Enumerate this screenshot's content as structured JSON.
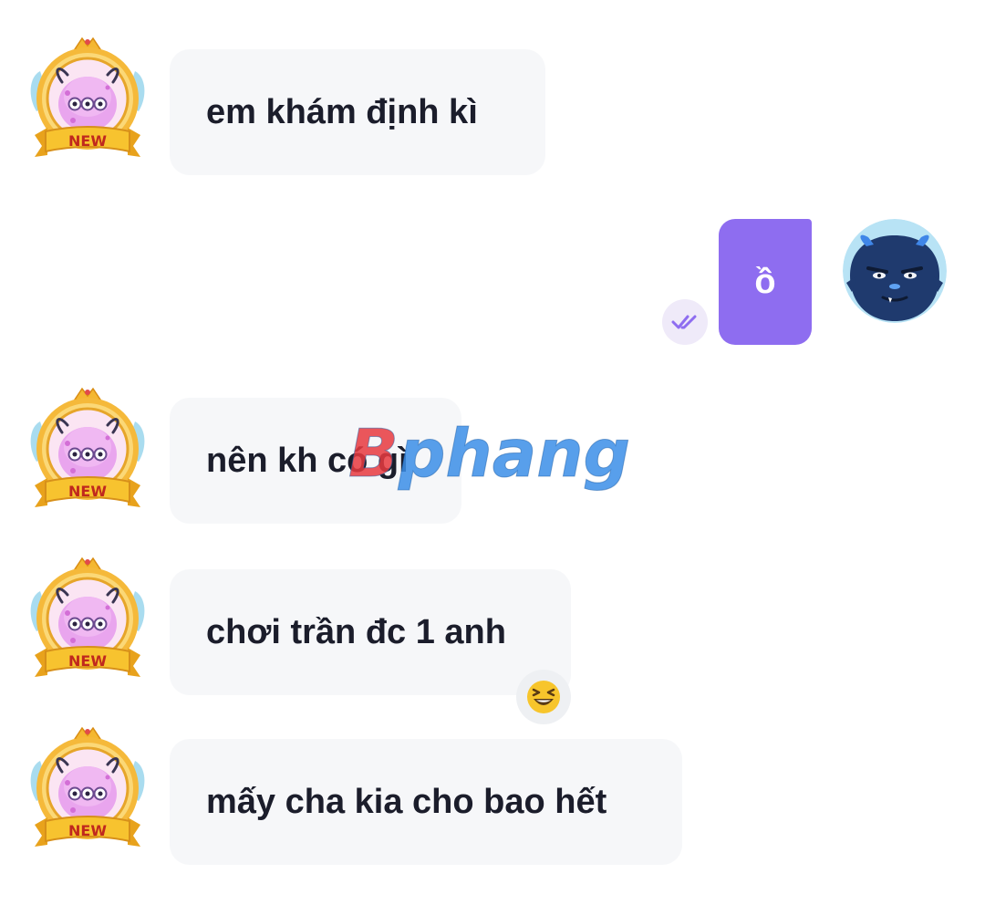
{
  "messages": [
    {
      "sender": "other",
      "text": "em khám định kì",
      "badge": "NEW"
    },
    {
      "sender": "me",
      "text": "ồ"
    },
    {
      "sender": "other",
      "text": "nên kh có gì",
      "badge": "NEW"
    },
    {
      "sender": "other",
      "text": "chơi trần đc 1 anh",
      "badge": "NEW",
      "reaction": "laughing-emoji"
    },
    {
      "sender": "other",
      "text": "mấy cha kia cho bao hết",
      "badge": "NEW"
    }
  ],
  "watermark": {
    "text": "Bphang"
  },
  "colors": {
    "incoming_bubble": "#f6f7f9",
    "outgoing_bubble": "#8e6df0",
    "text": "#1b1d2b",
    "read_receipt": "#8e6df0",
    "watermark_red": "#e83a3f",
    "watermark_blue": "#3b8ee8"
  },
  "icons": {
    "incoming_avatar": "pink-monster-new-badge-avatar",
    "my_avatar": "blue-monster-avatar",
    "read_receipt": "double-check-icon",
    "reaction": "laughing-emoji"
  }
}
